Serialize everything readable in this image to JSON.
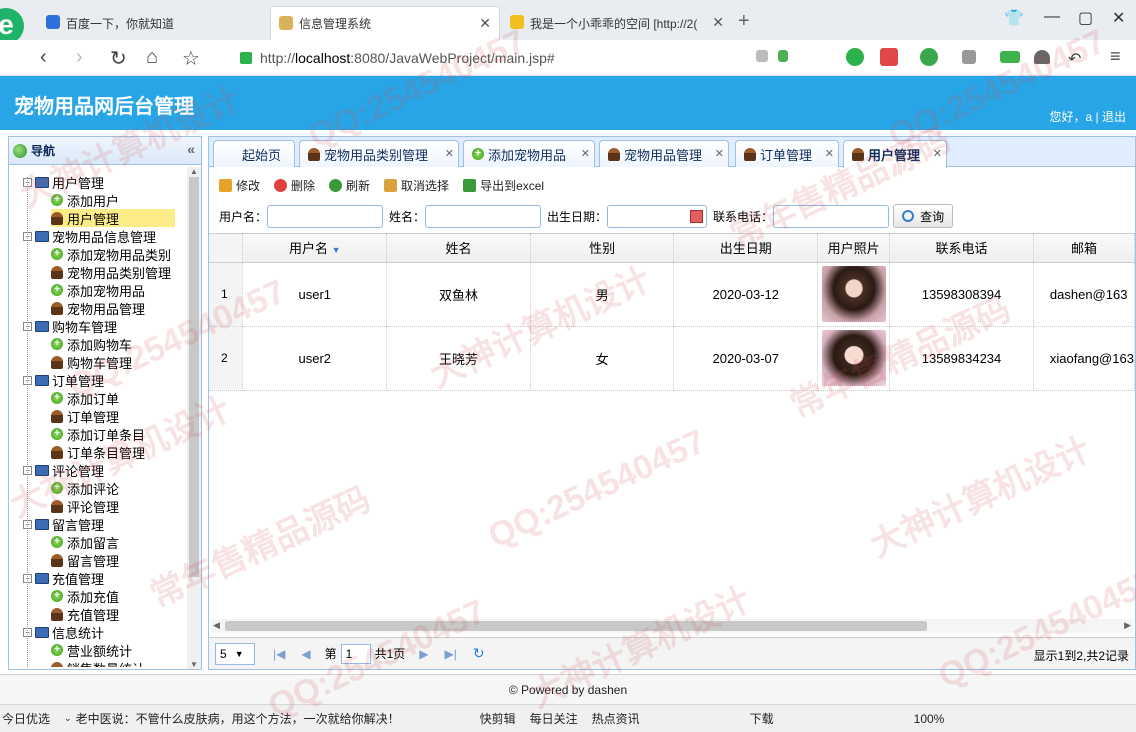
{
  "browser": {
    "tabs": [
      {
        "label": "百度一下，你就知道"
      },
      {
        "label": "信息管理系统"
      },
      {
        "label": "我是一个小乖乖的空间 [http://2("
      }
    ],
    "url_prefix": "http://",
    "url_host": "localhost",
    "url_rest": ":8080/JavaWebProject/main.jsp#"
  },
  "app": {
    "title": "宠物用品网后台管理",
    "user_greeting": "您好，a",
    "logout": "退出"
  },
  "nav": {
    "title": "导航",
    "collapse_glyph": "«",
    "nodes": [
      {
        "label": "用户管理"
      },
      {
        "label": "添加用户"
      },
      {
        "label": "用户管理"
      },
      {
        "label": "宠物用品信息管理"
      },
      {
        "label": "添加宠物用品类别"
      },
      {
        "label": "宠物用品类别管理"
      },
      {
        "label": "添加宠物用品"
      },
      {
        "label": "宠物用品管理"
      },
      {
        "label": "购物车管理"
      },
      {
        "label": "添加购物车"
      },
      {
        "label": "购物车管理"
      },
      {
        "label": "订单管理"
      },
      {
        "label": "添加订单"
      },
      {
        "label": "订单管理"
      },
      {
        "label": "添加订单条目"
      },
      {
        "label": "订单条目管理"
      },
      {
        "label": "评论管理"
      },
      {
        "label": "添加评论"
      },
      {
        "label": "评论管理"
      },
      {
        "label": "留言管理"
      },
      {
        "label": "添加留言"
      },
      {
        "label": "留言管理"
      },
      {
        "label": "充值管理"
      },
      {
        "label": "添加充值"
      },
      {
        "label": "充值管理"
      },
      {
        "label": "信息统计"
      },
      {
        "label": "营业额统计"
      },
      {
        "label": "销售数量统计"
      }
    ]
  },
  "tabs": [
    {
      "label": "起始页"
    },
    {
      "label": "宠物用品类别管理"
    },
    {
      "label": "添加宠物用品"
    },
    {
      "label": "宠物用品管理"
    },
    {
      "label": "订单管理"
    },
    {
      "label": "用户管理"
    }
  ],
  "toolbar": {
    "edit": "修改",
    "delete": "删除",
    "refresh": "刷新",
    "cancel_select": "取消选择",
    "export": "导出到excel"
  },
  "search": {
    "username_label": "用户名：",
    "name_label": "姓名：",
    "birth_label": "出生日期：",
    "phone_label": "联系电话：",
    "query": "查询"
  },
  "table": {
    "headers": [
      "用户名",
      "姓名",
      "性别",
      "出生日期",
      "用户照片",
      "联系电话",
      "邮箱"
    ],
    "rows": [
      {
        "num": "1",
        "username": "user1",
        "name": "双鱼林",
        "gender": "男",
        "birth": "2020-03-12",
        "phone": "13598308394",
        "email": "dashen@163"
      },
      {
        "num": "2",
        "username": "user2",
        "name": "王晓芳",
        "gender": "女",
        "birth": "2020-03-07",
        "phone": "13589834234",
        "email": "xiaofang@163"
      }
    ]
  },
  "pager": {
    "page_size": "5",
    "page_prefix": "第",
    "page": "1",
    "page_suffix": "共1页",
    "info": "显示1到2,共2记录"
  },
  "footer": {
    "text": "© Powered by dashen"
  },
  "statusbar": {
    "items": [
      "今日优选",
      "老中医说：不管什么皮肤病，用这个方法，一次就给你解决！",
      "快剪辑",
      "每日关注",
      "热点资讯",
      "下载",
      "100%"
    ]
  },
  "watermarks": [
    "QQ:254540457",
    "大神计算机设计",
    "常年售精品源码"
  ],
  "colors": {
    "header": "#27a5e6",
    "selected_row": "#fbec88"
  }
}
